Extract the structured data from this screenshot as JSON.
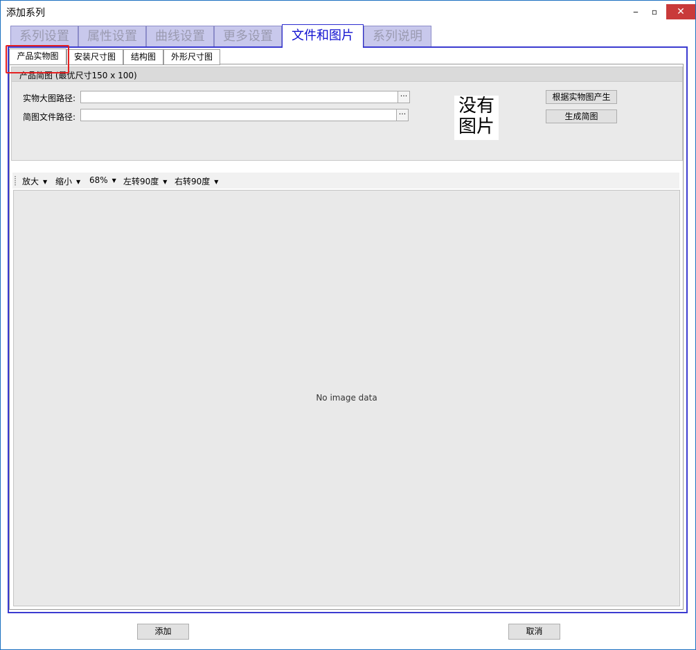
{
  "window": {
    "title": "添加系列",
    "controls": {
      "minimize": "‒",
      "maximize": "▫",
      "close": "✕"
    }
  },
  "main_tabs": [
    {
      "label": "系列设置",
      "active": false
    },
    {
      "label": "属性设置",
      "active": false
    },
    {
      "label": "曲线设置",
      "active": false
    },
    {
      "label": "更多设置",
      "active": false
    },
    {
      "label": "文件和图片",
      "active": true
    },
    {
      "label": "系列说明",
      "active": false
    }
  ],
  "sub_tabs": [
    {
      "label": "产品实物图",
      "active": true
    },
    {
      "label": "安装尺寸图",
      "active": false
    },
    {
      "label": "结构图",
      "active": false
    },
    {
      "label": "外形尺寸图",
      "active": false
    }
  ],
  "group": {
    "title": "产品简图 (最优尺寸150 x 100)",
    "photo_path_label": "实物大图路径:",
    "photo_path_value": "",
    "thumb_path_label": "简图文件路径:",
    "thumb_path_value": "",
    "browse_label": "···",
    "no_image_text": "没有图片",
    "generate_from_photo_button": "根据实物图产生",
    "generate_thumb_button": "生成简图"
  },
  "viewer_toolbar": {
    "zoom_in": "放大",
    "zoom_out": "缩小",
    "zoom_level": "68%",
    "rotate_left": "左转90度",
    "rotate_right": "右转90度"
  },
  "viewer": {
    "empty_text": "No image data"
  },
  "footer": {
    "add_button": "添加",
    "cancel_button": "取消"
  },
  "colors": {
    "active_tab_text": "#1010d0",
    "active_tab_border": "#2b2bd0",
    "inactive_tab_bg": "#c8c8ec",
    "highlight_box": "#e52020",
    "close_button": "#c93a3a"
  }
}
